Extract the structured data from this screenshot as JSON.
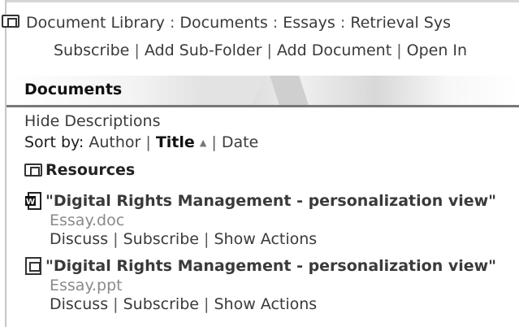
{
  "breadcrumb": {
    "items": [
      "Document Library",
      "Documents",
      "Essays",
      "Retrieval Sys"
    ],
    "separator": " : "
  },
  "folder_actions": {
    "items": [
      "Subscribe",
      "Add Sub-Folder",
      "Add Document",
      "Open In"
    ],
    "separator": " | "
  },
  "section": {
    "title": "Documents"
  },
  "view": {
    "hide_descriptions": "Hide Descriptions",
    "sort_label": "Sort by:",
    "sort_author": "Author",
    "sort_title": "Title",
    "sort_date": "Date",
    "sort_arrow": "▲",
    "sort_active": "title"
  },
  "folders": [
    {
      "name": "Resources",
      "icon": "folder-icon"
    }
  ],
  "documents": [
    {
      "title": "\"Digital Rights Management - personalization view\"",
      "file": "Essay.doc",
      "icon": "word-doc-icon",
      "actions": [
        "Discuss",
        "Subscribe",
        "Show Actions"
      ]
    },
    {
      "title": "\"Digital Rights Management - personalization view\"",
      "file": "Essay.ppt",
      "icon": "ppt-doc-icon",
      "actions": [
        "Discuss",
        "Subscribe",
        "Show Actions"
      ]
    }
  ],
  "colors": {
    "text": "#1c1c1c",
    "muted": "#8a8a8a",
    "rule": "#777777"
  }
}
